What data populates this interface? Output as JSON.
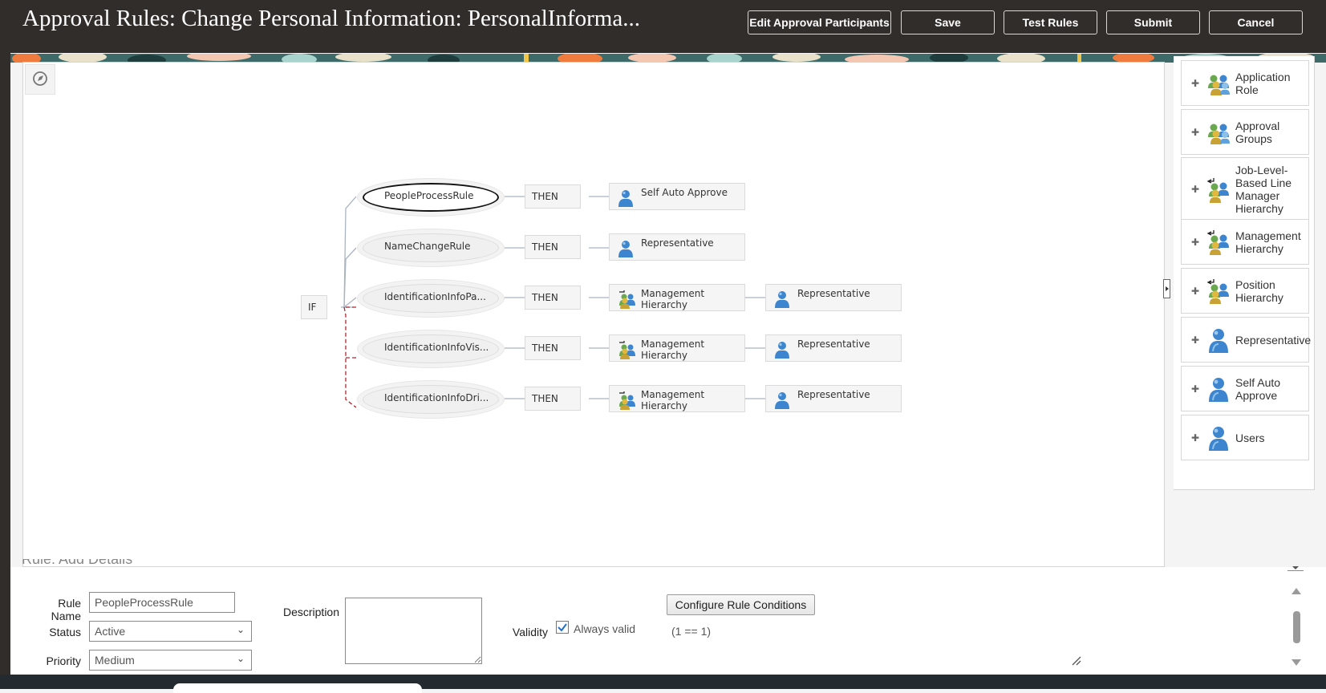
{
  "header": {
    "title": "Approval Rules: Change Personal Information: PersonalInforma...",
    "buttons": {
      "edit_participants": "Edit Approval Participants",
      "save": "Save",
      "test_rules": "Test Rules",
      "submit": "Submit",
      "cancel": "Cancel"
    }
  },
  "diagram": {
    "if_label": "IF",
    "then_label": "THEN",
    "rules": [
      {
        "name": "PeopleProcessRule",
        "selected": true,
        "actions": [
          "Self Auto Approve"
        ]
      },
      {
        "name": "NameChangeRule",
        "selected": false,
        "actions": [
          "Representative"
        ]
      },
      {
        "name": "IdentificationInfoPa...",
        "selected": false,
        "actions": [
          "Management Hierarchy",
          "Representative"
        ]
      },
      {
        "name": "IdentificationInfoVis...",
        "selected": false,
        "actions": [
          "Management Hierarchy",
          "Representative"
        ]
      },
      {
        "name": "IdentificationInfoDri...",
        "selected": false,
        "actions": [
          "Management Hierarchy",
          "Representative"
        ]
      }
    ]
  },
  "palette": {
    "items": [
      {
        "label": "Application Role",
        "icon": "group-icon"
      },
      {
        "label": "Approval Groups",
        "icon": "group-icon"
      },
      {
        "label": "Job-Level-Based Line Manager Hierarchy",
        "icon": "hierarchy-icon"
      },
      {
        "label": "Management Hierarchy",
        "icon": "hierarchy-icon"
      },
      {
        "label": "Position Hierarchy",
        "icon": "hierarchy-icon"
      },
      {
        "label": "Representative",
        "icon": "user-icon"
      },
      {
        "label": "Self Auto Approve",
        "icon": "user-icon"
      },
      {
        "label": "Users",
        "icon": "user-icon"
      }
    ]
  },
  "form": {
    "section_title": "Rule: Add Details",
    "rule_name_label": "Rule Name",
    "rule_name_value": "PeopleProcessRule",
    "status_label": "Status",
    "status_value": "Active",
    "priority_label": "Priority",
    "priority_value": "Medium",
    "description_label": "Description",
    "validity_label": "Validity",
    "always_valid_label": "Always valid",
    "always_valid_checked": true,
    "configure_button": "Configure Rule Conditions",
    "condition_text": "(1 == 1)"
  },
  "colors": {
    "header_bg": "#312d2a",
    "header_text": "#ffffff",
    "branch_red": "#c0202a",
    "connector": "#aab4c0",
    "person_blue": "#3d86cf"
  }
}
